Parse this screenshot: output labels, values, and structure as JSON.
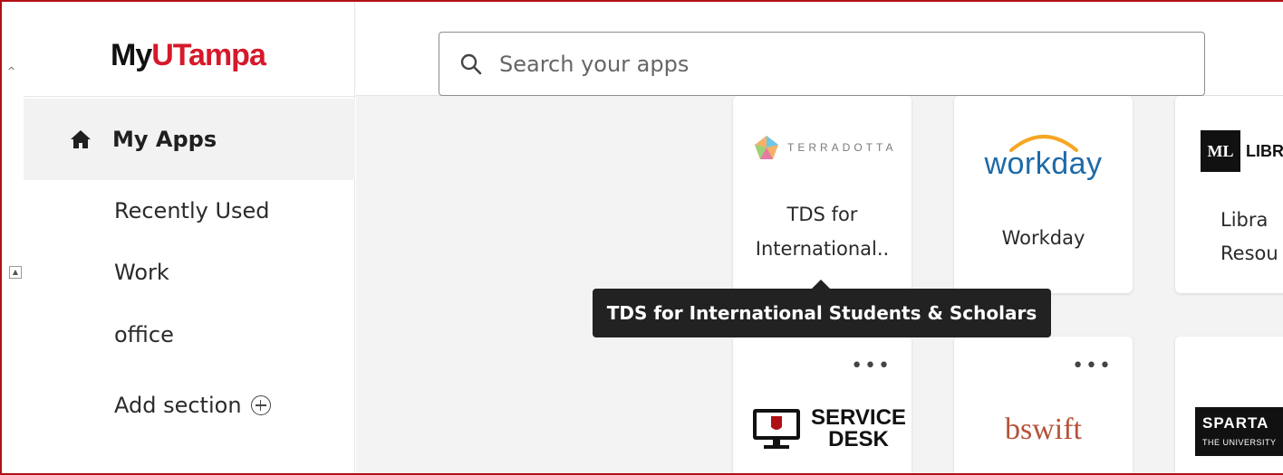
{
  "logo": {
    "part1": "My",
    "part2": "UTampa"
  },
  "sidebar": {
    "active": {
      "label": "My Apps",
      "icon": "home-icon"
    },
    "items": [
      {
        "label": "Recently Used"
      },
      {
        "label": "Work"
      },
      {
        "label": "office"
      }
    ],
    "add_section": {
      "label": "Add section",
      "icon": "plus-circle-icon"
    }
  },
  "search": {
    "placeholder": "Search your apps",
    "icon": "search-icon"
  },
  "apps": [
    {
      "logo_text": "TERRADOTTA",
      "title_line1": "TDS for",
      "title_line2": "International.."
    },
    {
      "logo_text": "workday",
      "title": "Workday"
    },
    {
      "logo_box": "ML",
      "logo_text": "LIBR",
      "title_line1": "Libra",
      "title_line2": "Resou"
    },
    {
      "logo_text_line1": "SERVICE",
      "logo_text_line2": "DESK",
      "menu": "•••"
    },
    {
      "logo_text": "bswift",
      "menu": "•••"
    },
    {
      "logo_text_line1": "SPARTA",
      "logo_text_line2": "THE UNIVERSITY"
    }
  ],
  "tooltip": {
    "text": "TDS for International Students & Scholars"
  },
  "colors": {
    "brand_red": "#d6192a",
    "workday_blue": "#1e6aa8",
    "bswift_orange": "#b5533a"
  }
}
